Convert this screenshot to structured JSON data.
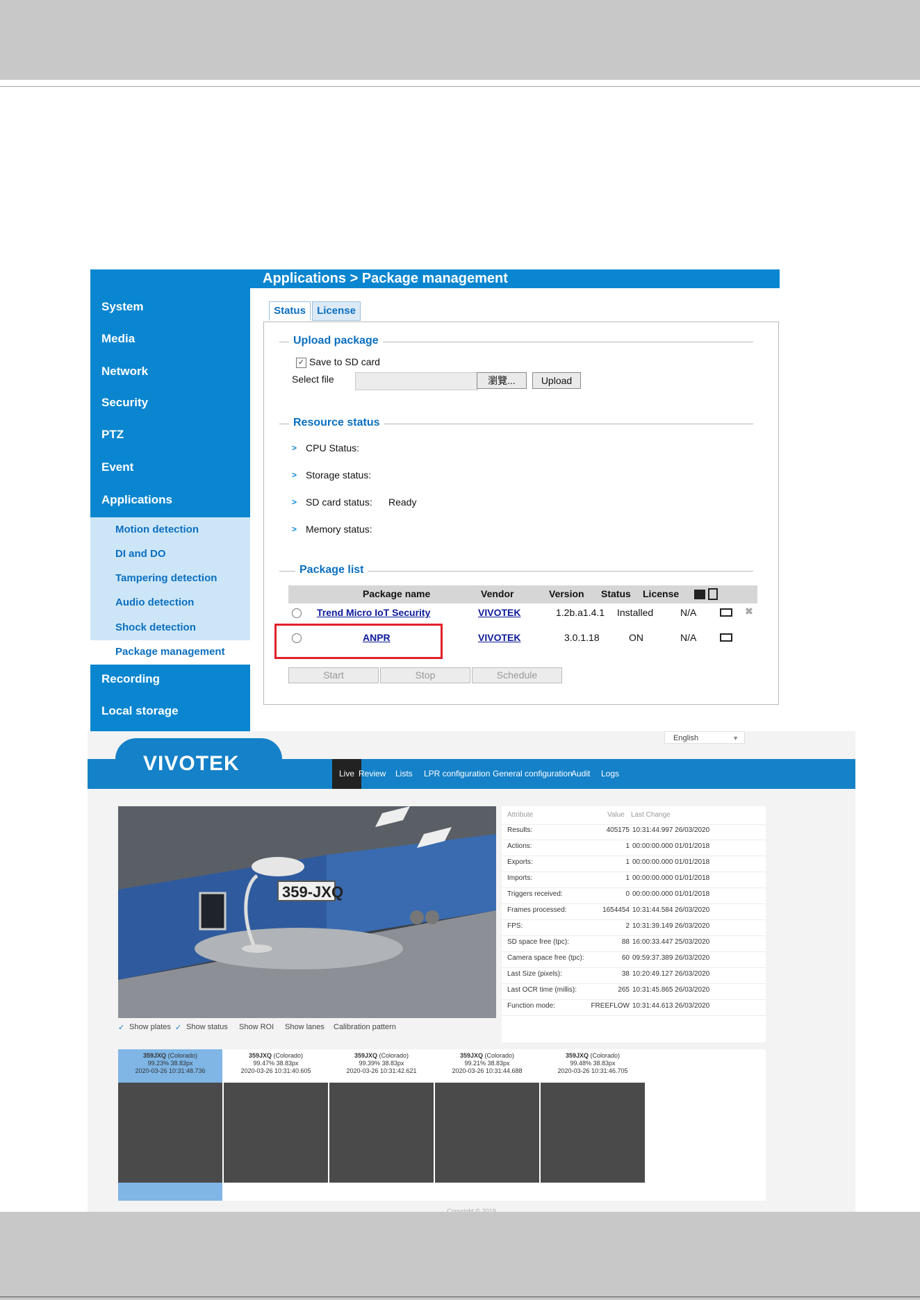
{
  "admin": {
    "title": "Applications  > Package management",
    "sidebar": {
      "items": [
        "System",
        "Media",
        "Network",
        "Security",
        "PTZ",
        "Event",
        "Applications"
      ],
      "sub_items": [
        "Motion detection",
        "DI and DO",
        "Tampering detection",
        "Audio detection",
        "Shock detection",
        "Package management"
      ],
      "items_after": [
        "Recording",
        "Local storage"
      ]
    },
    "tabs": [
      "Status",
      "License"
    ],
    "upload": {
      "legend": "Upload package",
      "save_label": "Save to SD card",
      "select_file_label": "Select file",
      "browse_label": "瀏覽...",
      "upload_label": "Upload"
    },
    "resource": {
      "legend": "Resource status",
      "rows": [
        {
          "label": "CPU Status:",
          "value": ""
        },
        {
          "label": "Storage status:",
          "value": ""
        },
        {
          "label": "SD card status:",
          "value": "Ready"
        },
        {
          "label": "Memory status:",
          "value": ""
        }
      ]
    },
    "package_list": {
      "legend": "Package list",
      "headers": {
        "name": "Package name",
        "vendor": "Vendor",
        "version": "Version",
        "status": "Status",
        "license": "License"
      },
      "rows": [
        {
          "name": "Trend Micro IoT Security",
          "vendor": "VIVOTEK",
          "version": "1.2b.a1.4.1",
          "status": "Installed",
          "license": "N/A"
        },
        {
          "name": "ANPR",
          "vendor": "VIVOTEK",
          "version": "3.0.1.18",
          "status": "ON",
          "license": "N/A"
        }
      ],
      "buttons": {
        "start": "Start",
        "stop": "Stop",
        "schedule": "Schedule"
      }
    },
    "colors": {
      "sidebar": "#0a86d0",
      "highlight": "#e0202a"
    }
  },
  "lpr": {
    "language": "English",
    "logo": "VIVOTEK",
    "nav": [
      "Live",
      "Review",
      "Lists",
      "LPR configuration",
      "General configuration",
      "Audit",
      "Logs"
    ],
    "plate": "359-JXQ",
    "attr_headers": {
      "attribute": "Attribute",
      "value": "Value",
      "last_change": "Last Change"
    },
    "attributes": [
      {
        "name": "Results:",
        "value": "405175",
        "time": "10:31:44.997 26/03/2020"
      },
      {
        "name": "Actions:",
        "value": "1",
        "time": "00:00:00.000 01/01/2018"
      },
      {
        "name": "Exports:",
        "value": "1",
        "time": "00:00:00.000 01/01/2018"
      },
      {
        "name": "Imports:",
        "value": "1",
        "time": "00:00:00.000 01/01/2018"
      },
      {
        "name": "Triggers received:",
        "value": "0",
        "time": "00:00:00.000 01/01/2018"
      },
      {
        "name": "Frames processed:",
        "value": "1654454",
        "time": "10:31:44.584 26/03/2020"
      },
      {
        "name": "FPS:",
        "value": "2",
        "time": "10:31:39.149 26/03/2020"
      },
      {
        "name": "SD space free (tpc):",
        "value": "88",
        "time": "16:00:33.447 25/03/2020"
      },
      {
        "name": "Camera space free (tpc):",
        "value": "60",
        "time": "09:59:37.389 26/03/2020"
      },
      {
        "name": "Last Size (pixels):",
        "value": "38",
        "time": "10:20:49.127 26/03/2020"
      },
      {
        "name": "Last OCR time (millis):",
        "value": "265",
        "time": "10:31:45.865 26/03/2020"
      },
      {
        "name": "Function mode:",
        "value": "FREEFLOW",
        "time": "10:31:44.613 26/03/2020"
      }
    ],
    "options": [
      "Show plates",
      "Show status",
      "Show ROI",
      "Show lanes",
      "Calibration pattern"
    ],
    "detections": [
      {
        "plate": "359JXQ",
        "region": "(Colorado)",
        "stats": "99.23% 38.83px",
        "time": "2020-03-26 10:31:48.736"
      },
      {
        "plate": "359JXQ",
        "region": "(Colorado)",
        "stats": "99.47% 38.83px",
        "time": "2020-03-26 10:31:40.605"
      },
      {
        "plate": "359JXQ",
        "region": "(Colorado)",
        "stats": "99.39% 38.83px",
        "time": "2020-03-26 10:31:42.621"
      },
      {
        "plate": "359JXQ",
        "region": "(Colorado)",
        "stats": "99.21% 38.83px",
        "time": "2020-03-26 10:31:44.688"
      },
      {
        "plate": "359JXQ",
        "region": "(Colorado)",
        "stats": "99.48% 38.83px",
        "time": "2020-03-26 10:31:46.705"
      }
    ],
    "copyright": "Copyright © 2019"
  }
}
